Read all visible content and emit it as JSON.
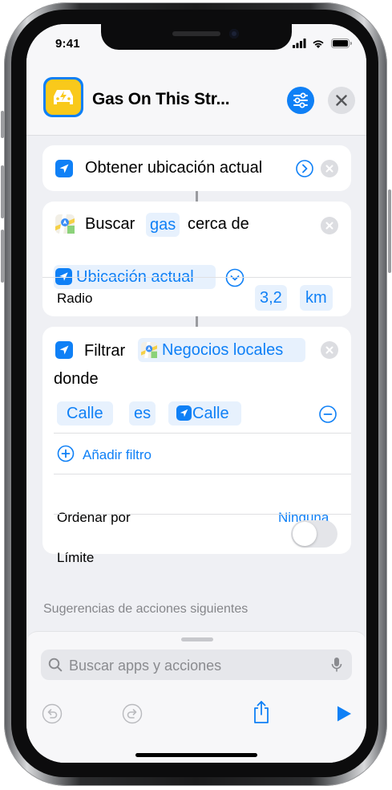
{
  "status_bar": {
    "time": "9:41"
  },
  "header": {
    "title": "Gas On This Str..."
  },
  "actions": {
    "get_location": {
      "label": "Obtener ubicación actual"
    },
    "search": {
      "verb": "Buscar",
      "query": "gas",
      "near_label": "cerca de",
      "location_token": "Ubicación actual",
      "radius_label": "Radio",
      "radius_value": "3,2",
      "radius_unit": "km"
    },
    "filter": {
      "verb": "Filtrar",
      "input_token": "Negocios locales",
      "where_label": "donde",
      "condition_field": "Calle",
      "condition_operator": "es",
      "condition_value": "Calle",
      "add_filter_label": "Añadir filtro",
      "sort_label": "Ordenar por",
      "sort_value": "Ninguna",
      "limit_label": "Límite",
      "limit_enabled": false
    }
  },
  "suggestions": {
    "header": "Sugerencias de acciones siguientes"
  },
  "search_bar": {
    "placeholder": "Buscar apps y acciones"
  },
  "colors": {
    "accent": "#0f80f6",
    "app_icon": "#f9c91b",
    "background": "#eff0f4"
  },
  "icons": [
    "location-arrow-icon",
    "maps-icon",
    "settings-sliders-icon",
    "close-icon",
    "chevron-right-icon",
    "chevron-down-icon",
    "minus-circle-icon",
    "plus-circle-icon",
    "microphone-icon",
    "undo-icon",
    "redo-icon",
    "share-icon",
    "play-icon",
    "car-icon"
  ]
}
